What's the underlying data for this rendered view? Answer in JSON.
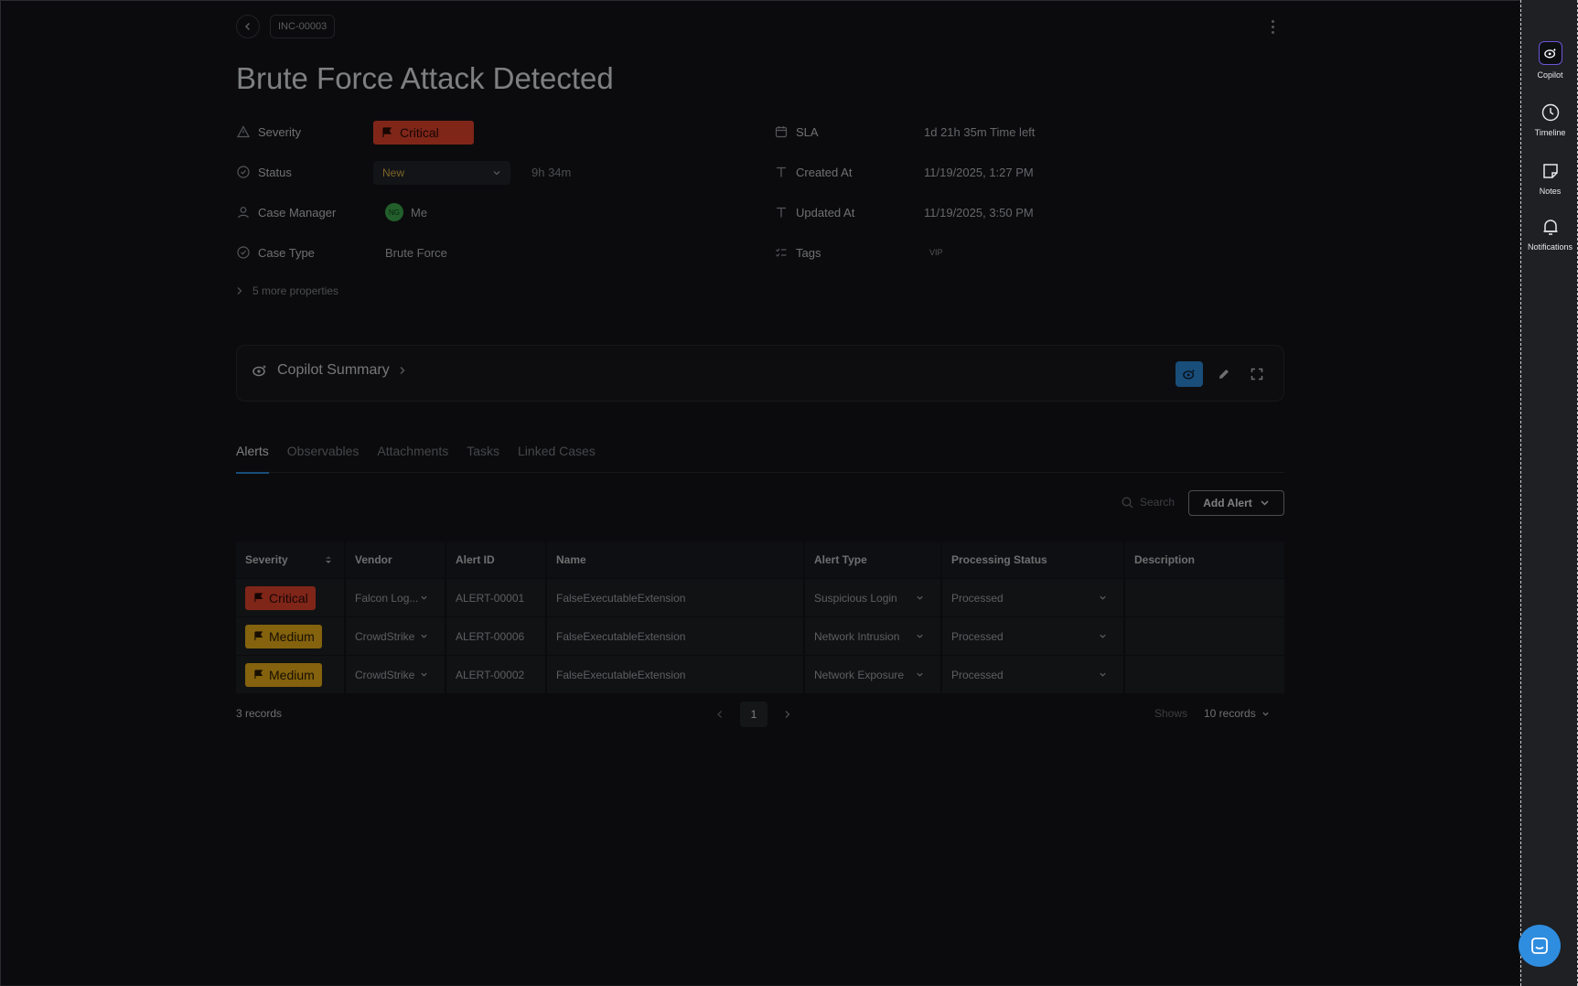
{
  "header": {
    "case_id": "INC-00003",
    "title": "Brute Force Attack Detected"
  },
  "properties": {
    "severity": {
      "label": "Severity",
      "value": "Critical"
    },
    "status": {
      "label": "Status",
      "value": "New",
      "elapsed": "9h 34m"
    },
    "case_manager": {
      "label": "Case Manager",
      "initials": "NG",
      "value": "Me"
    },
    "case_type": {
      "label": "Case Type",
      "value": "Brute Force"
    },
    "sla": {
      "label": "SLA",
      "value": "1d 21h 35m  Time left"
    },
    "created_at": {
      "label": "Created At",
      "value": "11/19/2025, 1:27 PM"
    },
    "updated_at": {
      "label": "Updated At",
      "value": "11/19/2025, 3:50 PM"
    },
    "tags": {
      "label": "Tags",
      "value": "VIP"
    },
    "more": "5 more properties"
  },
  "summary": {
    "title": "Copilot Summary"
  },
  "tabs": [
    {
      "label": "Alerts",
      "active": true
    },
    {
      "label": "Observables"
    },
    {
      "label": "Attachments"
    },
    {
      "label": "Tasks"
    },
    {
      "label": "Linked Cases"
    }
  ],
  "toolbar": {
    "search_placeholder": "Search",
    "add_alert": "Add Alert"
  },
  "table": {
    "headers": [
      "Severity",
      "Vendor",
      "Alert ID",
      "Name",
      "Alert Type",
      "Processing Status",
      "Description"
    ],
    "rows": [
      {
        "severity": "Critical",
        "vendor": "Falcon Log...",
        "alert_id": "ALERT-00001",
        "name": "FalseExecutableExtension",
        "alert_type": "Suspicious Login",
        "status": "Processed",
        "description": ""
      },
      {
        "severity": "Medium",
        "vendor": "CrowdStrike",
        "alert_id": "ALERT-00006",
        "name": "FalseExecutableExtension",
        "alert_type": "Network Intrusion",
        "status": "Processed",
        "description": ""
      },
      {
        "severity": "Medium",
        "vendor": "CrowdStrike",
        "alert_id": "ALERT-00002",
        "name": "FalseExecutableExtension",
        "alert_type": "Network Exposure",
        "status": "Processed",
        "description": ""
      }
    ]
  },
  "footer": {
    "records": "3 records",
    "page": "1",
    "shows_label": "Shows",
    "per_page": "10 records"
  },
  "rightbar": {
    "copilot": "Copilot",
    "timeline": "Timeline",
    "notes": "Notes",
    "notifications": "Notifications"
  },
  "colors": {
    "critical": "#e8452f",
    "medium": "#f0b21a",
    "accent": "#2f8ddf"
  }
}
